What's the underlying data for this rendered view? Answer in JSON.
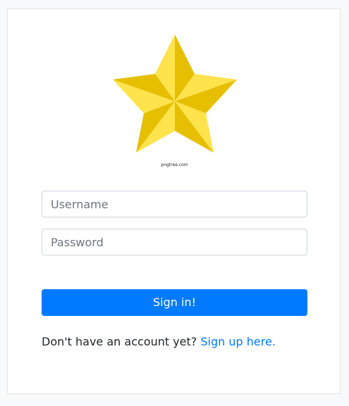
{
  "logo": {
    "icon": "star-icon",
    "caption": "pngtree.com",
    "colors": {
      "light": "#ffe34d",
      "dark": "#e6bf00"
    }
  },
  "form": {
    "username_placeholder": "Username",
    "username_value": "",
    "password_placeholder": "Password",
    "password_value": "",
    "submit_label": "Sign in!"
  },
  "footer": {
    "prompt": "Don't have an account yet?",
    "link_label": "Sign up here."
  },
  "colors": {
    "accent": "#007bff",
    "background": "#f8f9fa",
    "card": "#ffffff"
  }
}
